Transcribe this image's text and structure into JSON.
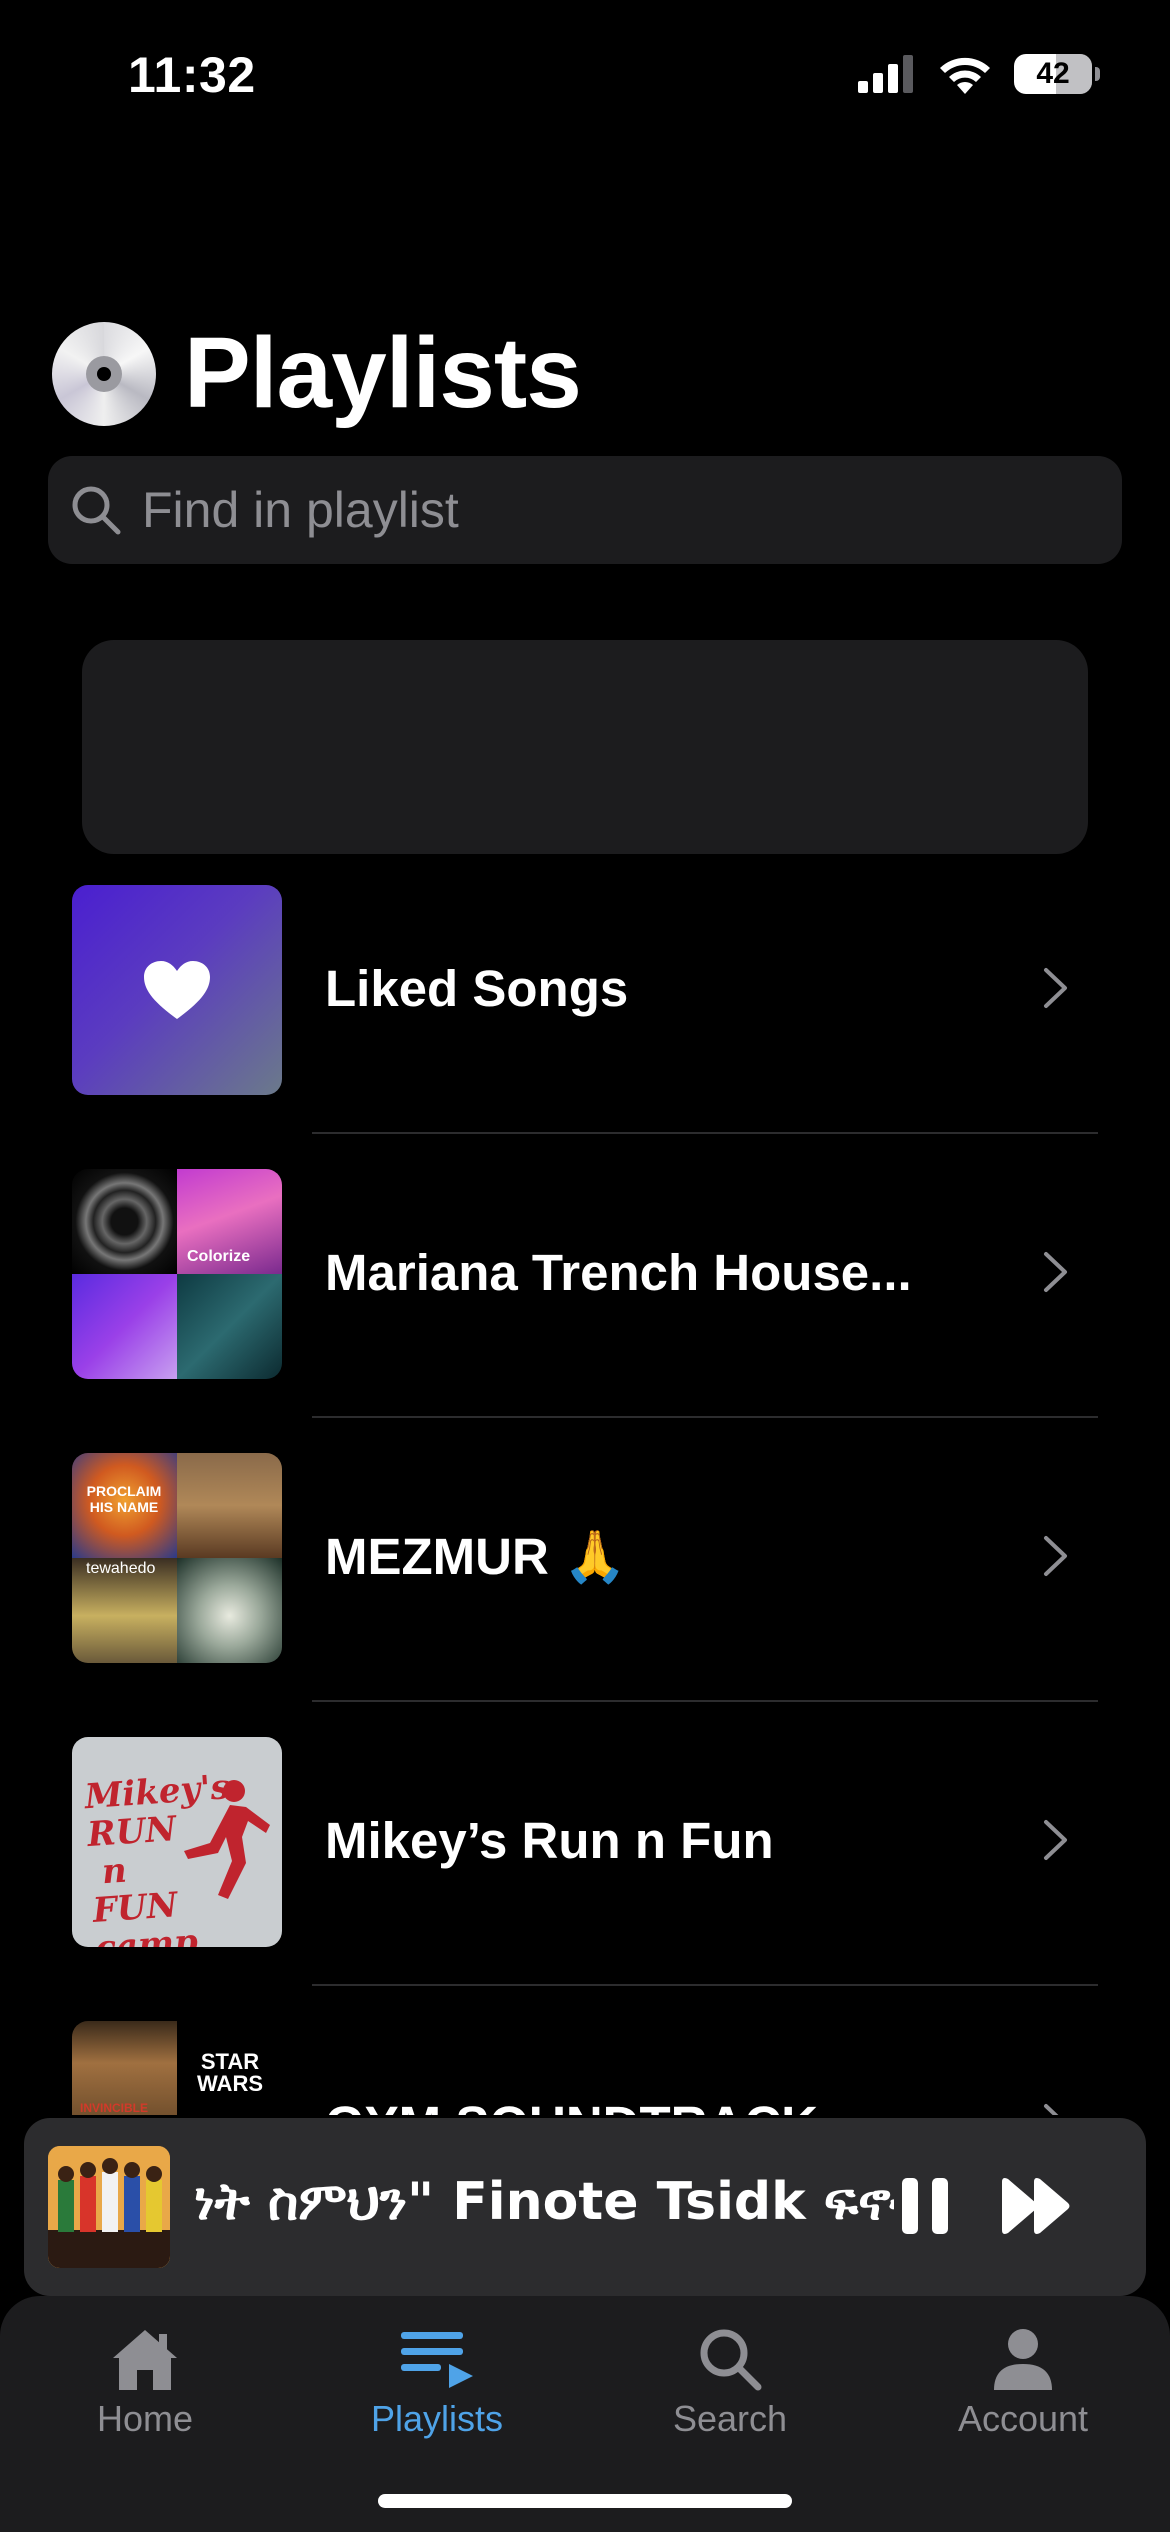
{
  "status_bar": {
    "time": "11:32",
    "battery": "42"
  },
  "header": {
    "title": "Playlists",
    "icon": "cd-icon"
  },
  "search": {
    "placeholder": "Find in playlist"
  },
  "playlists": [
    {
      "name": "Liked Songs",
      "icon": "heart-icon"
    },
    {
      "name": "Mariana Trench House...",
      "art_text": "Colorize"
    },
    {
      "name": "MEZMUR 🙏",
      "art_text_1": "PROCLAIM HIS NAME",
      "art_text_2": "tewahedo"
    },
    {
      "name": "Mikey’s Run n Fun",
      "art_text": "Mikey's\nRUN\n n\nFUN\ncamp"
    },
    {
      "name": "GYM SOUNDTRACK",
      "art_text_1": "STAR WARS",
      "art_text_2": "INVINCIBLE"
    }
  ],
  "now_playing": {
    "title": "ነት ስምህን\" Finote Tsidk ፍኖተ ጽድቅ"
  },
  "tabs": [
    {
      "label": "Home",
      "icon": "home-icon",
      "active": false
    },
    {
      "label": "Playlists",
      "icon": "playlists-icon",
      "active": true
    },
    {
      "label": "Search",
      "icon": "search-icon",
      "active": false
    },
    {
      "label": "Account",
      "icon": "account-icon",
      "active": false
    }
  ],
  "colors": {
    "background": "#000000",
    "surface": "#1c1c1e",
    "accent": "#4fa3e8",
    "inactive": "#8e8e93"
  }
}
